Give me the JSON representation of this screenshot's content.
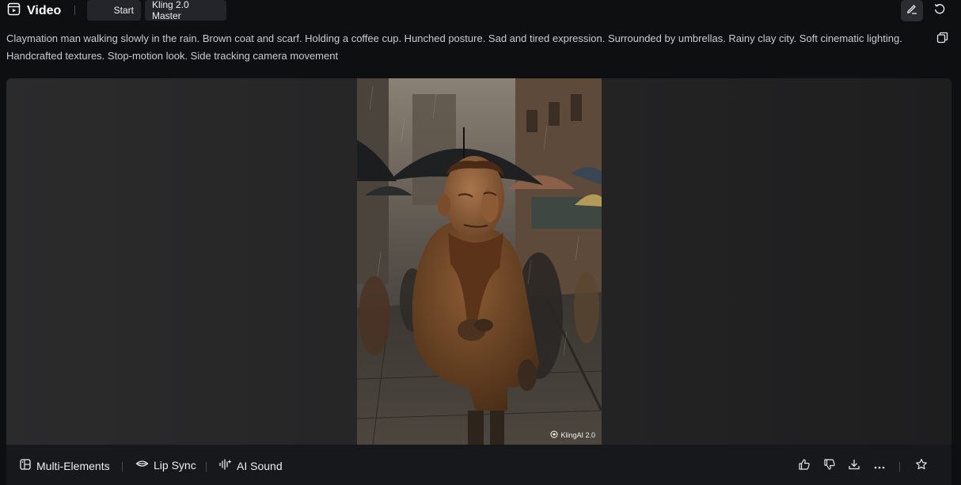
{
  "header": {
    "title": "Video",
    "start_label": "Start",
    "model_label": "Kling 2.0 Master"
  },
  "prompt_text": "Claymation man walking slowly in the rain. Brown coat and scarf. Holding a coffee cup. Hunched posture. Sad and tired expression. Surrounded by umbrellas. Rainy clay city. Soft cinematic lighting. Handcrafted textures. Stop-motion look. Side tracking camera movement",
  "video": {
    "watermark": "KlingAI 2.0"
  },
  "toolbar": {
    "multi_elements": "Multi-Elements",
    "lip_sync": "Lip Sync",
    "ai_sound": "AI Sound"
  },
  "icons": [
    "video-icon",
    "edit-icon",
    "undo-icon",
    "copy-icon",
    "multi-elements-icon",
    "lip-sync-icon",
    "ai-sound-icon",
    "thumbs-up-icon",
    "thumbs-down-icon",
    "download-icon",
    "more-icon",
    "star-icon"
  ]
}
